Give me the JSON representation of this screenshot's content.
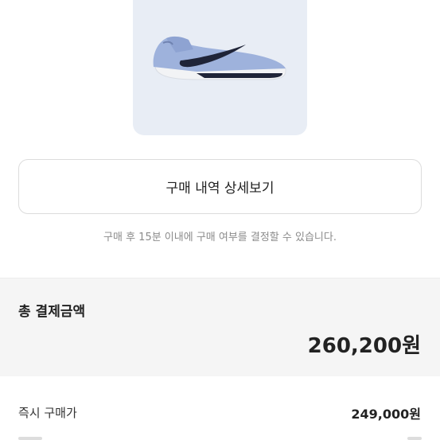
{
  "product": {
    "image_icon": "sneaker-image",
    "colors": {
      "card_bg": "#e8edf5",
      "upper": "#9eb2dc",
      "sole": "#f2f3f5",
      "swoosh": "#1f2438"
    }
  },
  "history_button": {
    "label": "구매 내역 상세보기"
  },
  "notice": {
    "text": "구매 후 15분 이내에 구매 여부를 결정할 수 있습니다."
  },
  "payment": {
    "title": "총 결제금액",
    "amount": "260,200원"
  },
  "price_rows": [
    {
      "label": "즉시 구매가",
      "value": "249,000원"
    }
  ]
}
